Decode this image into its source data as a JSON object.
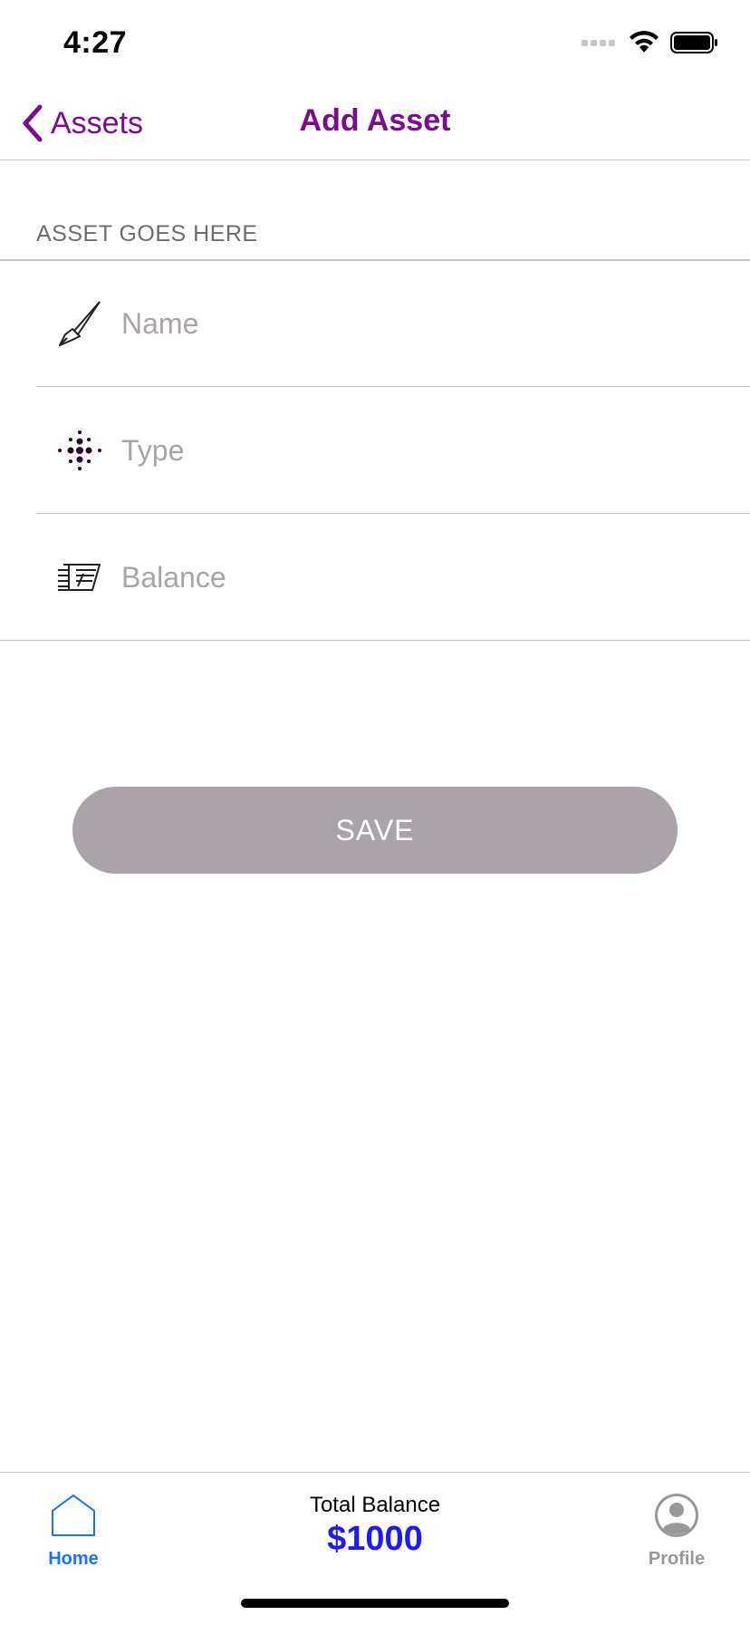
{
  "status_bar": {
    "time": "4:27"
  },
  "nav": {
    "back_label": "Assets",
    "title": "Add Asset"
  },
  "form": {
    "section_header": "ASSET GOES HERE",
    "fields": [
      {
        "icon": "paintbrush-icon",
        "value": "",
        "placeholder": "Name"
      },
      {
        "icon": "dots-grid-icon",
        "value": "",
        "placeholder": "Type"
      },
      {
        "icon": "money-stack-icon",
        "value": "",
        "placeholder": "Balance"
      }
    ],
    "save_label": "SAVE"
  },
  "tab_bar": {
    "home_label": "Home",
    "profile_label": "Profile",
    "total_label": "Total Balance",
    "total_value": "$1000"
  },
  "colors": {
    "accent_purple": "#7a0b8c",
    "save_button": "#aaa3aa",
    "tab_active": "#1a73ff",
    "total_value": "#1a1aff",
    "tab_inactive": "#999999"
  }
}
